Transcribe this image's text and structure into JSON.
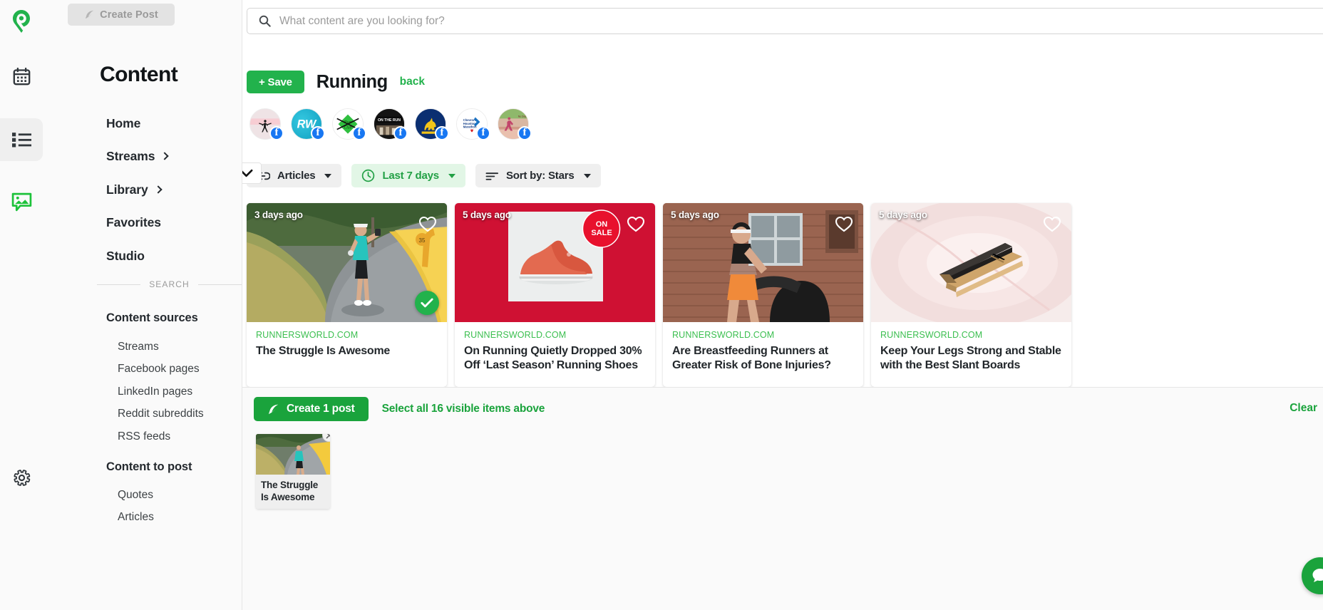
{
  "rail": {
    "items": [
      {
        "name": "logo",
        "icon": "location-pin-icon"
      },
      {
        "name": "calendar",
        "icon": "calendar-icon"
      },
      {
        "name": "list",
        "icon": "list-icon"
      },
      {
        "name": "media",
        "icon": "image-icon"
      },
      {
        "name": "settings",
        "icon": "gear-icon"
      }
    ]
  },
  "sidebar": {
    "create_post_label": "Create Post",
    "title": "Content",
    "nav": [
      {
        "label": "Home",
        "chevron": false
      },
      {
        "label": "Streams",
        "chevron": true
      },
      {
        "label": "Library",
        "chevron": true
      },
      {
        "label": "Favorites",
        "chevron": false
      },
      {
        "label": "Studio",
        "chevron": false
      }
    ],
    "divider_label": "SEARCH",
    "content_sources_title": "Content sources",
    "content_sources": [
      "Streams",
      "Facebook pages",
      "LinkedIn pages",
      "Reddit subreddits",
      "RSS feeds"
    ],
    "content_to_post_title": "Content to post",
    "content_to_post": [
      "Quotes",
      "Articles"
    ]
  },
  "search": {
    "placeholder": "What content are you looking for?",
    "icon": "search-icon"
  },
  "header": {
    "save_label": "+ Save",
    "title": "Running",
    "back_label": "back"
  },
  "avatars": [
    {
      "name": "runner-silhouette-page",
      "network": "facebook",
      "bg": "#f4e4e6"
    },
    {
      "name": "runners-world-page",
      "network": "facebook",
      "bg": "#1fb6d4",
      "text": "RW"
    },
    {
      "name": "run-club-diamond-page",
      "network": "facebook",
      "bg": "#ffffff"
    },
    {
      "name": "on-the-run-page",
      "network": "facebook",
      "bg": "#1b1b1b",
      "text": "ON THE RUN"
    },
    {
      "name": "unicorn-marathon-page",
      "network": "facebook",
      "bg": "#0c2c6b"
    },
    {
      "name": "chevron-houston-marathon-page",
      "network": "facebook",
      "bg": "#ffffff"
    },
    {
      "name": "race-photo-page",
      "network": "facebook",
      "bg": "#e8b2a0"
    }
  ],
  "filters": [
    {
      "label": "Articles",
      "icon": "link-icon",
      "active": false,
      "caret": true
    },
    {
      "label": "Last 7 days",
      "icon": "clock-icon",
      "active": true,
      "caret": true
    },
    {
      "label": "Sort by: Stars",
      "icon": "sort-icon",
      "active": false,
      "caret": true
    }
  ],
  "cards": [
    {
      "time": "3 days ago",
      "source": "RUNNERSWORLD.COM",
      "title": "The Struggle Is Awesome",
      "selected": true,
      "favorite": false,
      "image": "road-runner-photo"
    },
    {
      "time": "5 days ago",
      "source": "RUNNERSWORLD.COM",
      "title": "On Running Quietly Dropped 30% Off ‘Last Season’ Running Shoes",
      "selected": false,
      "favorite": false,
      "image": "red-shoe-sale-photo"
    },
    {
      "time": "5 days ago",
      "source": "RUNNERSWORLD.COM",
      "title": "Are Breastfeeding Runners at Greater Risk of Bone Injuries?",
      "selected": false,
      "favorite": false,
      "image": "runner-with-stroller-photo"
    },
    {
      "time": "5 days ago",
      "source": "RUNNERSWORLD.COM",
      "title": "Keep Your Legs Strong and Stable with the Best Slant Boards",
      "selected": false,
      "favorite": false,
      "image": "slant-board-photo"
    }
  ],
  "bottom": {
    "create_post_label": "Create 1 post",
    "select_all_label": "Select all 16 visible items above",
    "clear_label": "Clear",
    "selected_item": {
      "title": "The Struggle Is Awesome",
      "remove_icon": "close-icon"
    },
    "expander_icon": "chevron-down-icon",
    "fab_icon": "chat-icon"
  },
  "colors": {
    "green": "#22b24c",
    "green_dark": "#1aa33c",
    "green_light_bg": "#e2f6e6",
    "facebook_blue": "#1877f2",
    "source_green": "#3bbf4f"
  }
}
